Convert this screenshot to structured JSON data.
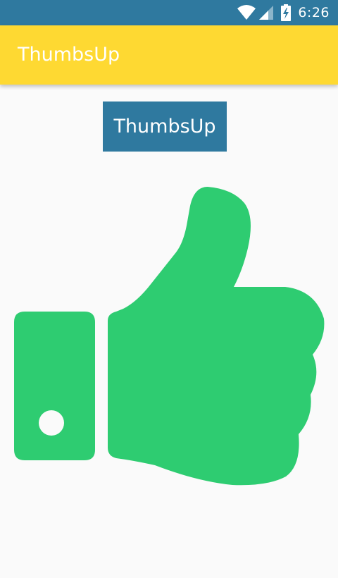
{
  "status_bar": {
    "time": "6:26",
    "icons": [
      "wifi-icon",
      "signal-icon",
      "battery-charging-icon"
    ]
  },
  "app_bar": {
    "title": "ThumbsUp"
  },
  "main": {
    "button_label": "ThumbsUp",
    "image_icon": "thumbs-up-icon"
  },
  "colors": {
    "status_bar": "#2f799f",
    "app_bar": "#fed932",
    "button": "#2f799f",
    "thumb": "#2ecc71",
    "background": "#fafafa"
  }
}
